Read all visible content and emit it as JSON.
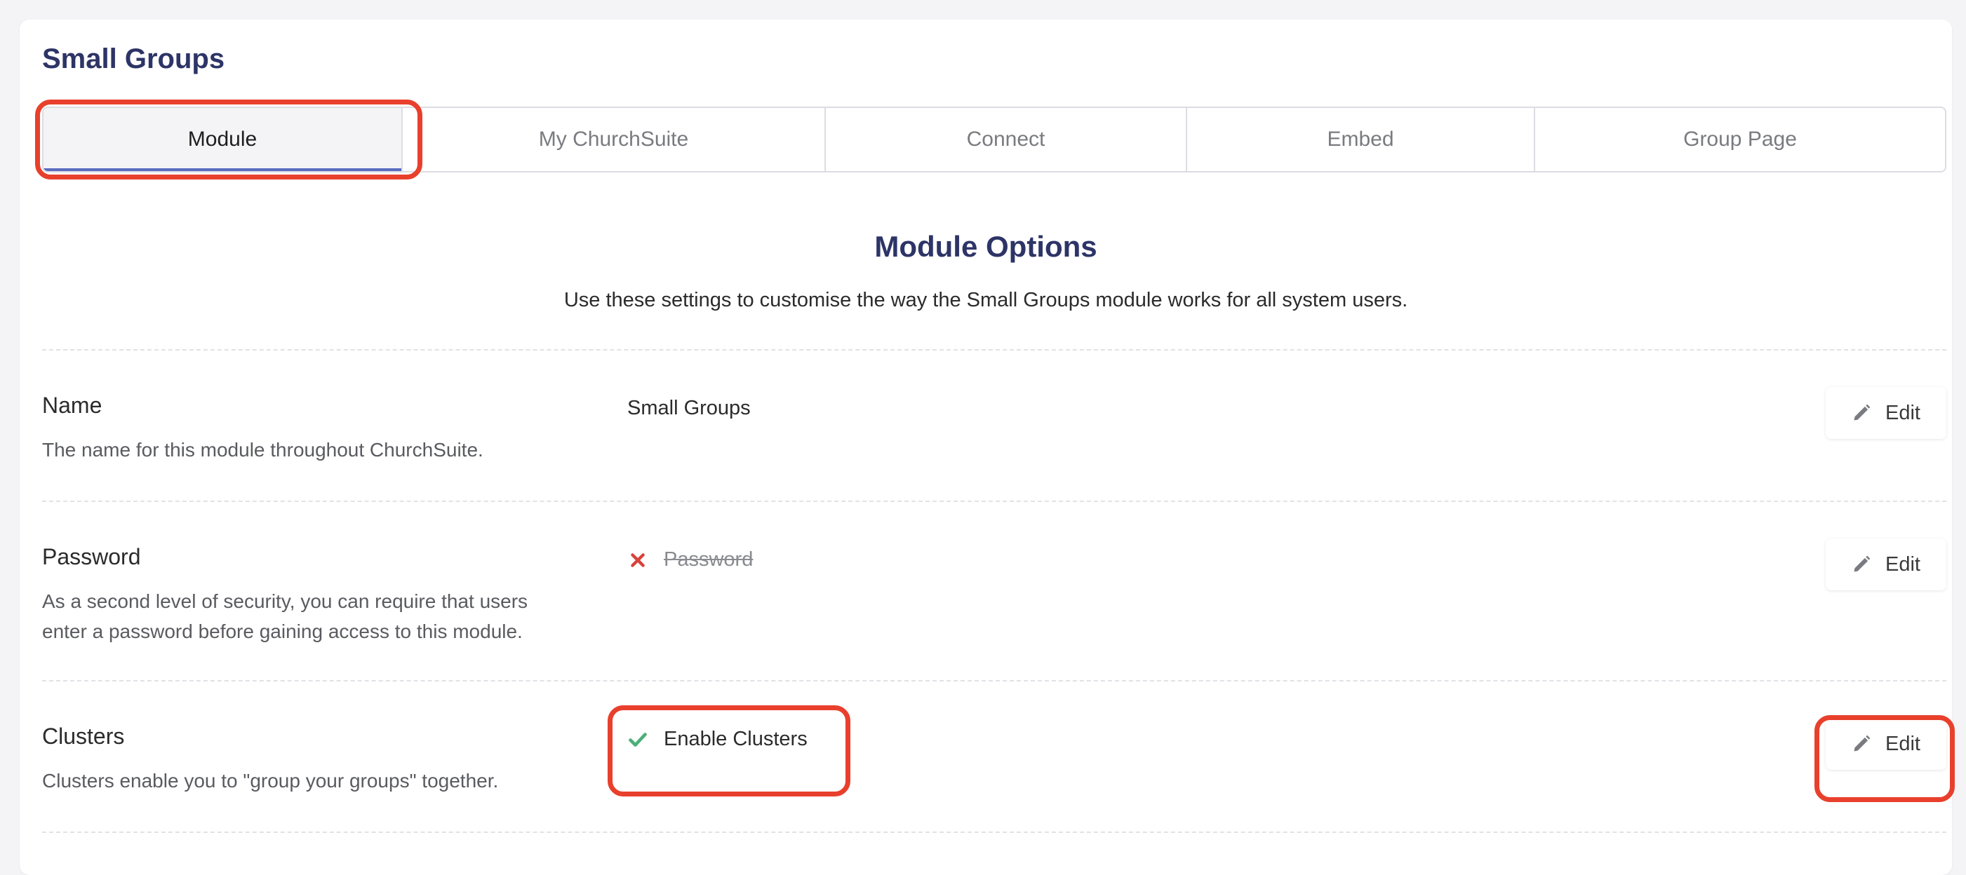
{
  "page": {
    "title": "Small Groups"
  },
  "tabs": [
    {
      "label": "Module",
      "active": true
    },
    {
      "label": "My ChurchSuite",
      "active": false
    },
    {
      "label": "Connect",
      "active": false
    },
    {
      "label": "Embed",
      "active": false
    },
    {
      "label": "Group Page",
      "active": false
    }
  ],
  "section": {
    "heading": "Module Options",
    "subtitle": "Use these settings to customise the way the Small Groups module works for all system users."
  },
  "settings": [
    {
      "label": "Name",
      "description": "The name for this module throughout ChurchSuite.",
      "value": "Small Groups",
      "status": "none",
      "edit_label": "Edit"
    },
    {
      "label": "Password",
      "description": "As a second level of security, you can require that users enter a password before gaining access to this module.",
      "value": "Password",
      "status": "disabled",
      "edit_label": "Edit"
    },
    {
      "label": "Clusters",
      "description": "Clusters enable you to \"group your groups\" together.",
      "value": "Enable Clusters",
      "status": "enabled",
      "edit_label": "Edit"
    }
  ],
  "colors": {
    "brand_title": "#2d3466",
    "highlight": "#e8402c",
    "enabled_check": "#4caf78",
    "disabled_cross": "#d9413a",
    "active_tab_underline": "#5a6bc0"
  },
  "icons": {
    "pencil": "pencil-icon",
    "check": "check-icon",
    "cross": "cross-icon"
  }
}
